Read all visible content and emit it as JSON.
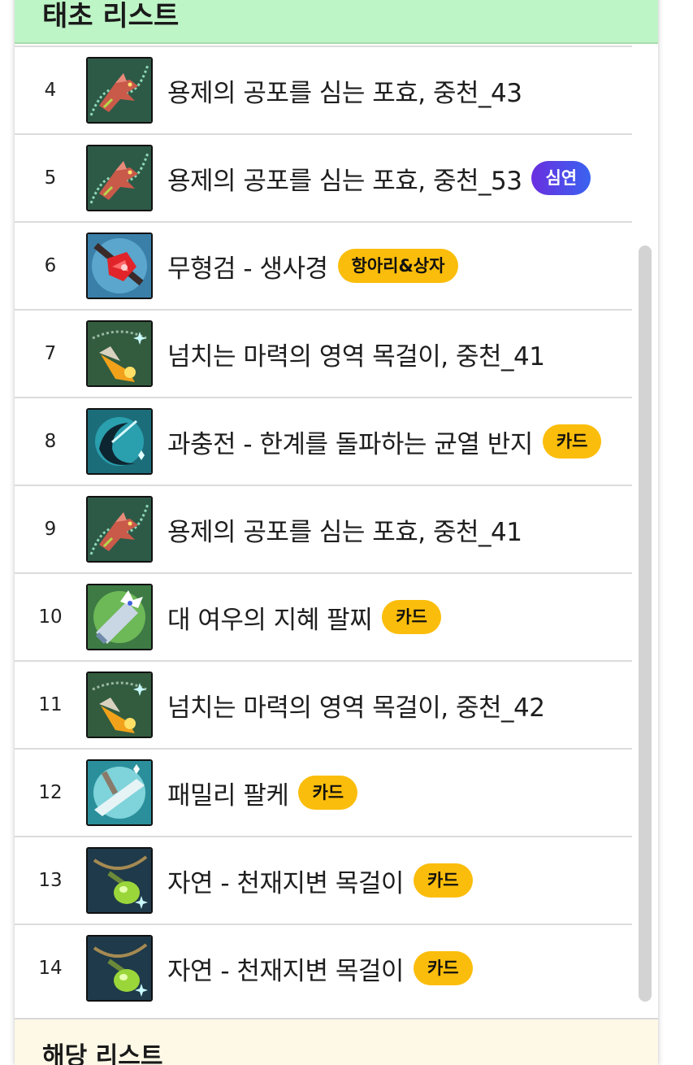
{
  "header": {
    "title": "태초 리스트"
  },
  "footer": {
    "title": "해당 리스트"
  },
  "colors": {
    "header_bg": "#bef5c6",
    "badge_yellow": "#fbbd0b",
    "badge_purple_start": "#6a2fe0",
    "badge_purple_end": "#3a63f0"
  },
  "items": [
    {
      "rank": "4",
      "icon": "dragon-pendant-icon",
      "name": "용제의 공포를 심는 포효, 중천_43",
      "badge": ""
    },
    {
      "rank": "5",
      "icon": "dragon-pendant-icon",
      "name": "용제의 공포를 심는 포효, 중천_53",
      "badge": "심연",
      "badge_style": "purple"
    },
    {
      "rank": "6",
      "icon": "sword-emblem-icon",
      "name": "무형검 - 생사경",
      "badge": "항아리&상자",
      "badge_style": "yellow"
    },
    {
      "rank": "7",
      "icon": "fire-necklace-icon",
      "name": "넘치는 마력의 영역 목걸이, 중천_41",
      "badge": ""
    },
    {
      "rank": "8",
      "icon": "crescent-ring-icon",
      "name": "과충전 - 한계를 돌파하는 균열 반지",
      "badge": "카드",
      "badge_style": "yellow"
    },
    {
      "rank": "9",
      "icon": "dragon-pendant-icon",
      "name": "용제의 공포를 심는 포효, 중천_41",
      "badge": ""
    },
    {
      "rank": "10",
      "icon": "fox-bracelet-icon",
      "name": "대 여우의 지혜 팔찌",
      "badge": "카드",
      "badge_style": "yellow"
    },
    {
      "rank": "11",
      "icon": "fire-necklace-icon",
      "name": "넘치는 마력의 영역 목걸이, 중천_42",
      "badge": ""
    },
    {
      "rank": "12",
      "icon": "family-bracelet-icon",
      "name": "패밀리 팔케",
      "badge": "카드",
      "badge_style": "yellow"
    },
    {
      "rank": "13",
      "icon": "green-gem-necklace-icon",
      "name": "자연 - 천재지변 목걸이",
      "badge": "카드",
      "badge_style": "yellow"
    },
    {
      "rank": "14",
      "icon": "green-gem-necklace-icon",
      "name": "자연 - 천재지변 목걸이",
      "badge": "카드",
      "badge_style": "yellow"
    }
  ]
}
